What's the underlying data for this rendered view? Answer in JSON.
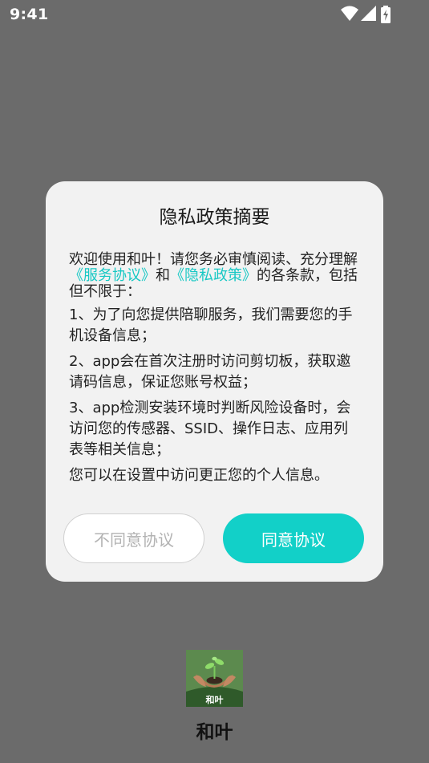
{
  "status_bar": {
    "time": "9:41",
    "icons": [
      "wifi-icon",
      "cellular-signal-icon",
      "battery-icon"
    ]
  },
  "dialog": {
    "title": "隐私政策摘要",
    "intro_prefix": "欢迎使用和叶！请您务必审慎阅读、充分理解",
    "service_link": "《服务协议》",
    "connector": "和",
    "privacy_link": "《隐私政策》",
    "intro_suffix": "的各条款，包括但不限于：",
    "clauses": [
      "1、为了向您提供陪聊服务，我们需要您的手机设备信息；",
      "2、app会在首次注册时访问剪切板，获取邀请码信息，保证您账号权益；",
      "3、app检测安装环境时判断风险设备时，会访问您的传感器、SSID、操作日志、应用列表等相关信息；",
      "您可以在设置中访问更正您的个人信息。"
    ],
    "decline_label": "不同意协议",
    "agree_label": "同意协议"
  },
  "app": {
    "logo_text": "和叶",
    "name": "和叶"
  },
  "colors": {
    "overlay": "#6b6b6b",
    "dialog_bg": "#f2f2f2",
    "accent": "#12d0c8",
    "link": "#18c8c4"
  }
}
